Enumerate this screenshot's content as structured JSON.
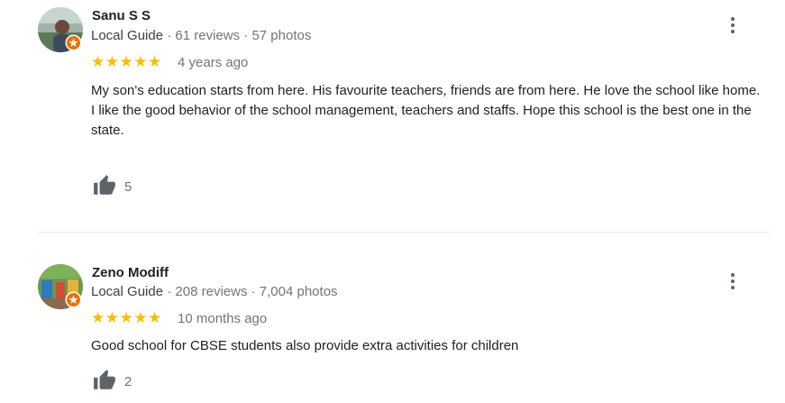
{
  "reviews": [
    {
      "name": "Sanu S S",
      "badge": "Local Guide",
      "reviews_count": "61 reviews",
      "photos_count": "57 photos",
      "rating": 5,
      "stars": "★★★★★",
      "time_ago": "4 years ago",
      "text_lines": [
        "My son's education starts from here. His favourite teachers, friends are from here. He love the school like home.",
        "I like the good behavior of the school management, teachers and staffs. Hope this school is the best one in the state."
      ],
      "likes": "5"
    },
    {
      "name": "Zeno Modiff",
      "badge": "Local Guide",
      "reviews_count": "208 reviews",
      "photos_count": "7,004 photos",
      "rating": 5,
      "stars": "★★★★★",
      "time_ago": "10 months ago",
      "text_lines": [
        "Good school for CBSE students also provide extra activities for children"
      ],
      "likes": "2"
    }
  ],
  "meta_separator": " · ",
  "colors": {
    "star": "#fbbc04",
    "badge_orange": "#e8710a",
    "secondary_text": "#70757a",
    "icon_gray": "#5f6368"
  },
  "icons": {
    "menu": "more-vert-icon",
    "like": "thumb-up-icon",
    "badge": "local-guide-badge-icon"
  }
}
